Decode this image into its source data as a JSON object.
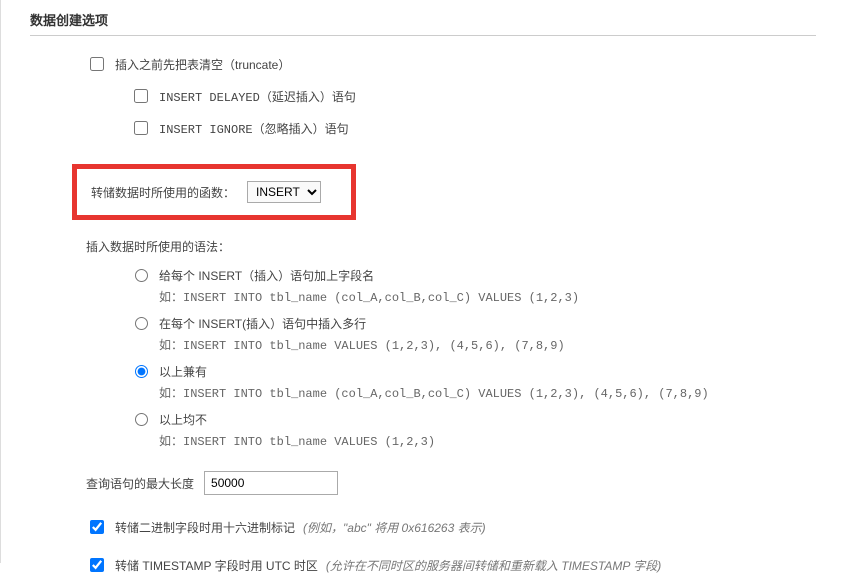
{
  "section_title": "数据创建选项",
  "truncate": {
    "label": "插入之前先把表清空（truncate）",
    "checked": false
  },
  "delayed": {
    "label": "INSERT DELAYED（延迟插入）语句",
    "checked": false
  },
  "ignore": {
    "label": "INSERT IGNORE（忽略插入）语句",
    "checked": false
  },
  "func": {
    "label": "转储数据时所使用的函数：",
    "value": "INSERT",
    "options": [
      "INSERT"
    ]
  },
  "syntax": {
    "label": "插入数据时所使用的语法：",
    "selected": "both",
    "options": {
      "columns": {
        "label": "给每个 INSERT（插入）语句加上字段名",
        "sub": "如：INSERT INTO tbl_name (col_A,col_B,col_C) VALUES (1,2,3)"
      },
      "multirow": {
        "label": "在每个 INSERT(插入）语句中插入多行",
        "sub": "如：INSERT INTO tbl_name VALUES (1,2,3), (4,5,6), (7,8,9)"
      },
      "both": {
        "label": "以上兼有",
        "sub": "如：INSERT INTO tbl_name (col_A,col_B,col_C) VALUES (1,2,3), (4,5,6), (7,8,9)"
      },
      "neither": {
        "label": "以上均不",
        "sub": "如：INSERT INTO tbl_name VALUES (1,2,3)"
      }
    }
  },
  "maxlen": {
    "label": "查询语句的最大长度",
    "value": "50000"
  },
  "hex": {
    "label": "转储二进制字段时用十六进制标记",
    "note": "(例如，\"abc\" 将用 0x616263 表示)",
    "checked": true
  },
  "utc": {
    "label": "转储 TIMESTAMP 字段时用 UTC 时区",
    "note": "(允许在不同时区的服务器间转储和重新载入 TIMESTAMP 字段)",
    "checked": true
  }
}
